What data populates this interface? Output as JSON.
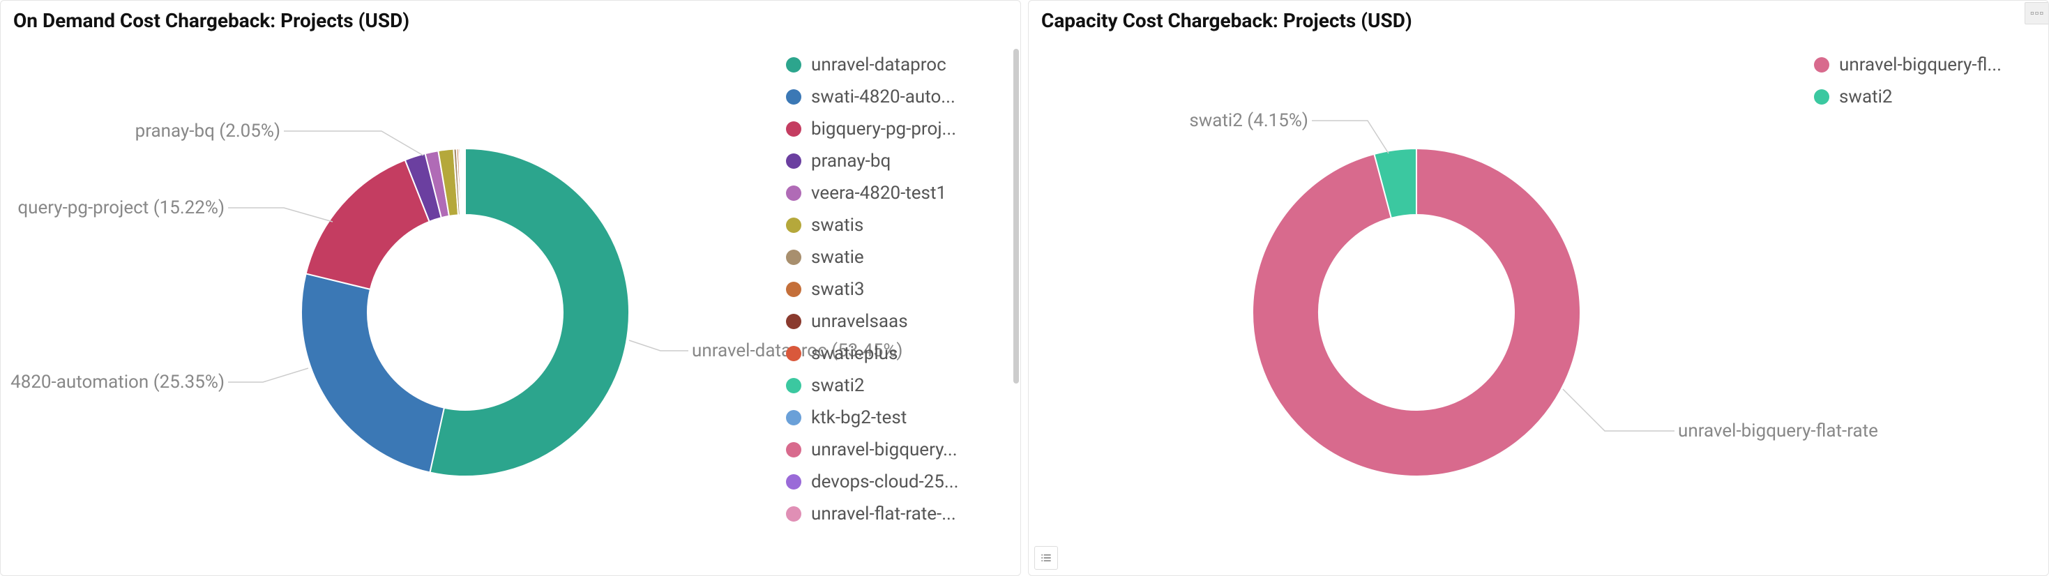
{
  "panels": [
    {
      "title": "On Demand Cost Chargeback: Projects (USD)",
      "legend_items": [
        {
          "label": "unravel-dataproc",
          "color": "#2ca58d"
        },
        {
          "label": "swati-4820-auto...",
          "color": "#3b78b5"
        },
        {
          "label": "bigquery-pg-proj...",
          "color": "#c43d61"
        },
        {
          "label": "pranay-bq",
          "color": "#6b3fa0"
        },
        {
          "label": "veera-4820-test1",
          "color": "#b06bb6"
        },
        {
          "label": "swatis",
          "color": "#b5a83b"
        },
        {
          "label": "swatie",
          "color": "#a88f6e"
        },
        {
          "label": "swati3",
          "color": "#c46f3a"
        },
        {
          "label": "unravelsaas",
          "color": "#8a3a2e"
        },
        {
          "label": "swatieplus",
          "color": "#d9583b"
        },
        {
          "label": "swati2",
          "color": "#3bc8a0"
        },
        {
          "label": "ktk-bg2-test",
          "color": "#6aa0d8"
        },
        {
          "label": "unravel-bigquery...",
          "color": "#d86a8d"
        },
        {
          "label": "devops-cloud-25...",
          "color": "#9a6ad8"
        },
        {
          "label": "unravel-flat-rate-...",
          "color": "#e08fb5"
        }
      ],
      "slice_labels": {
        "s0": "unravel-dataproc (53.45%)",
        "s1": "4820-automation (25.35%)",
        "s2": "query-pg-project (15.22%)",
        "s3": "pranay-bq (2.05%)"
      }
    },
    {
      "title": "Capacity Cost Chargeback: Projects (USD)",
      "legend_items": [
        {
          "label": "unravel-bigquery-fl...",
          "color": "#d86a8d"
        },
        {
          "label": "swati2",
          "color": "#3bc8a0"
        }
      ],
      "slice_labels": {
        "s0": "unravel-bigquery-flat-rate",
        "s1": "swati2 (4.15%)"
      }
    }
  ],
  "chart_data": [
    {
      "type": "pie",
      "title": "On Demand Cost Chargeback: Projects (USD)",
      "series": [
        {
          "name": "unravel-dataproc",
          "value": 53.45,
          "color": "#2ca58d"
        },
        {
          "name": "swati-4820-automation",
          "value": 25.35,
          "color": "#3b78b5"
        },
        {
          "name": "bigquery-pg-project",
          "value": 15.22,
          "color": "#c43d61"
        },
        {
          "name": "pranay-bq",
          "value": 2.05,
          "color": "#6b3fa0"
        },
        {
          "name": "veera-4820-test1",
          "value": 1.3,
          "color": "#b06bb6"
        },
        {
          "name": "swatis",
          "value": 1.5,
          "color": "#b5a83b"
        },
        {
          "name": "swatie",
          "value": 0.3,
          "color": "#a88f6e"
        },
        {
          "name": "swati3",
          "value": 0.2,
          "color": "#c46f3a"
        },
        {
          "name": "unravelsaas",
          "value": 0.15,
          "color": "#8a3a2e"
        },
        {
          "name": "swatieplus",
          "value": 0.12,
          "color": "#d9583b"
        },
        {
          "name": "swati2",
          "value": 0.1,
          "color": "#3bc8a0"
        },
        {
          "name": "ktk-bg2-test",
          "value": 0.08,
          "color": "#6aa0d8"
        },
        {
          "name": "unravel-bigquery",
          "value": 0.07,
          "color": "#d86a8d"
        },
        {
          "name": "devops-cloud-25",
          "value": 0.06,
          "color": "#9a6ad8"
        },
        {
          "name": "unravel-flat-rate",
          "value": 0.05,
          "color": "#e08fb5"
        }
      ]
    },
    {
      "type": "pie",
      "title": "Capacity Cost Chargeback: Projects (USD)",
      "series": [
        {
          "name": "unravel-bigquery-flat-rate",
          "value": 95.85,
          "color": "#d86a8d"
        },
        {
          "name": "swati2",
          "value": 4.15,
          "color": "#3bc8a0"
        }
      ]
    }
  ]
}
